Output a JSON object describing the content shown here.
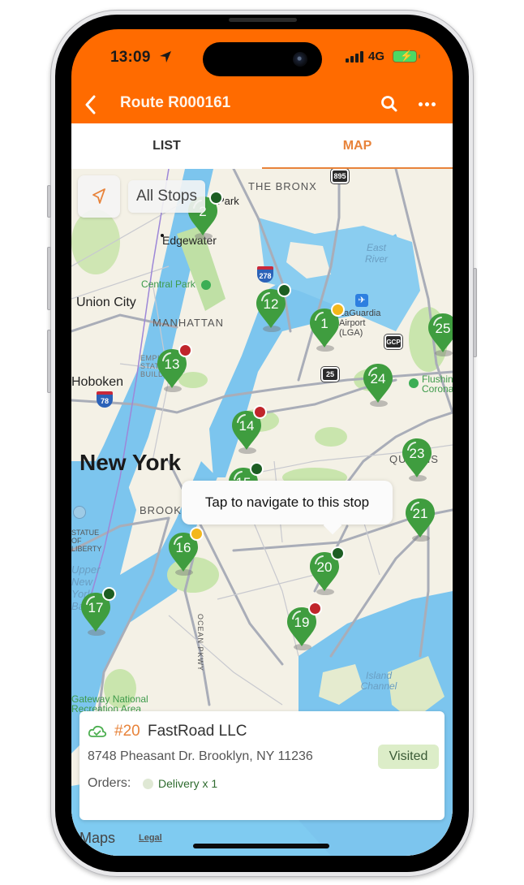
{
  "status_bar": {
    "time": "13:09",
    "network": "4G",
    "location_icon": "location-arrow-icon",
    "signal_icon": "signal-bars-icon",
    "battery_icon": "battery-charging-icon"
  },
  "nav": {
    "back_icon": "chevron-left-icon",
    "title": "Route R000161",
    "search_icon": "search-icon",
    "more_icon": "ellipsis-icon"
  },
  "tabs": [
    {
      "label": "LIST",
      "active": false
    },
    {
      "label": "MAP",
      "active": true
    }
  ],
  "colors": {
    "brand": "#ff6b00",
    "accent": "#e8833a",
    "pin_green": "#3f9d3f",
    "status_dark_green": "#1d5e23",
    "status_red": "#c0252b",
    "status_yellow": "#f3b71b",
    "visited_badge_bg": "#dcedc8"
  },
  "map_controls": {
    "locate_icon": "navigation-arrow-icon",
    "filter_label": "All Stops"
  },
  "map_labels": {
    "the_bronx": "THE BRONX",
    "park": "Park",
    "edgewater": "Edgewater",
    "central_park": "Central Park",
    "union_city": "Union City",
    "manhattan": "MANHATTAN",
    "hoboken": "Hoboken",
    "new_york": "New York",
    "empire_state": "EMPIRE STATE BUILDING",
    "east_river": "East River",
    "laguardia": "LaGuardia Airport (LGA)",
    "queens": "QUEENS",
    "brooklyn": "BROOKLYN",
    "statue": "STATUE OF LIBERTY",
    "upper_bay": "Upper New York Bay",
    "ocean_pkwy": "OCEAN PKWY",
    "gateway": "Gateway National Recreation Area",
    "island_channel": "Island Channel",
    "flushing": "Flushing Corona",
    "hw_895": "895",
    "hw_278": "278",
    "hw_gcp": "GCP",
    "hw_25": "25",
    "hw_78": "78"
  },
  "stops": [
    {
      "number": "2",
      "status": "dark-green"
    },
    {
      "number": "12",
      "status": "dark-green"
    },
    {
      "number": "1",
      "status": "yellow"
    },
    {
      "number": "25",
      "status": "none"
    },
    {
      "number": "13",
      "status": "red"
    },
    {
      "number": "24",
      "status": "none"
    },
    {
      "number": "14",
      "status": "red"
    },
    {
      "number": "23",
      "status": "none"
    },
    {
      "number": "15",
      "status": "dark-green"
    },
    {
      "number": "21",
      "status": "none"
    },
    {
      "number": "16",
      "status": "yellow"
    },
    {
      "number": "20",
      "status": "dark-green"
    },
    {
      "number": "17",
      "status": "dark-green"
    },
    {
      "number": "19",
      "status": "red"
    }
  ],
  "tooltip": {
    "text": "Tap to navigate to this stop"
  },
  "selected_stop": {
    "sync_icon": "cloud-check-icon",
    "number": "#20",
    "name": "FastRoad LLC",
    "address": "8748 Pheasant Dr. Brooklyn, NY 11236",
    "status": "Visited",
    "orders_label": "Orders:",
    "orders": [
      {
        "type": "Delivery",
        "quantity_text": "Delivery x 1"
      }
    ]
  },
  "map_footer": {
    "logo": "Maps",
    "legal": "Legal"
  }
}
